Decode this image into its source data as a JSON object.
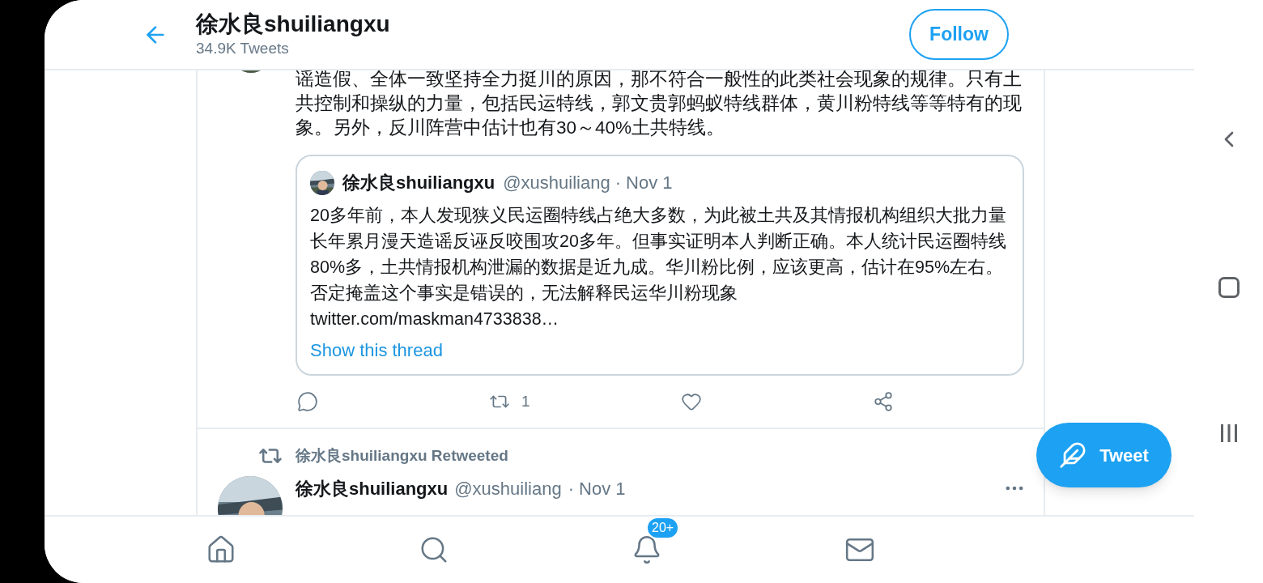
{
  "header": {
    "title": "徐水良shuiliangxu",
    "subtitle": "34.9K Tweets",
    "follow_button": "Follow"
  },
  "tweets": [
    {
      "kind": "quote_tweet",
      "text": "谣造假、全体一致坚持全力挺川的原因，那不符合一般性的此类社会现象的规律。只有土共控制和操纵的力量，包括民运特线，郭文贵郭蚂蚁特线群体，黄川粉特线等等特有的现象。另外，反川阵营中估计也有30～40%土共特线。",
      "quoted": {
        "name": "徐水良shuiliangxu",
        "handle": "@xushuiliang",
        "date": "· Nov 1",
        "text": "20多年前，本人发现狭义民运圈特线占绝大多数，为此被土共及其情报机构组织大批力量长年累月漫天造谣反诬反咬围攻20多年。但事实证明本人判断正确。本人统计民运圈特线80%多，土共情报机构泄漏的数据是近九成。华川粉比例，应该更高，估计在95%左右。否定掩盖这个事实是错误的，无法解释民运华川粉现象",
        "link": "twitter.com/maskman4733838…",
        "show_thread": "Show this thread"
      },
      "actions": [
        {
          "kind": "reply"
        },
        {
          "kind": "retweet",
          "count": "1"
        },
        {
          "kind": "like"
        },
        {
          "kind": "share"
        }
      ]
    },
    {
      "kind": "retweeted",
      "retweeted_by": "徐水良shuiliangxu Retweeted",
      "name": "徐水良shuiliangxu",
      "handle": "@xushuiliang",
      "date": "· Nov 1"
    }
  ],
  "fab": {
    "label": "Tweet"
  },
  "bottom_nav": [
    {
      "kind": "home"
    },
    {
      "kind": "search"
    },
    {
      "kind": "notifications",
      "badge": "20+"
    },
    {
      "kind": "messages"
    }
  ]
}
